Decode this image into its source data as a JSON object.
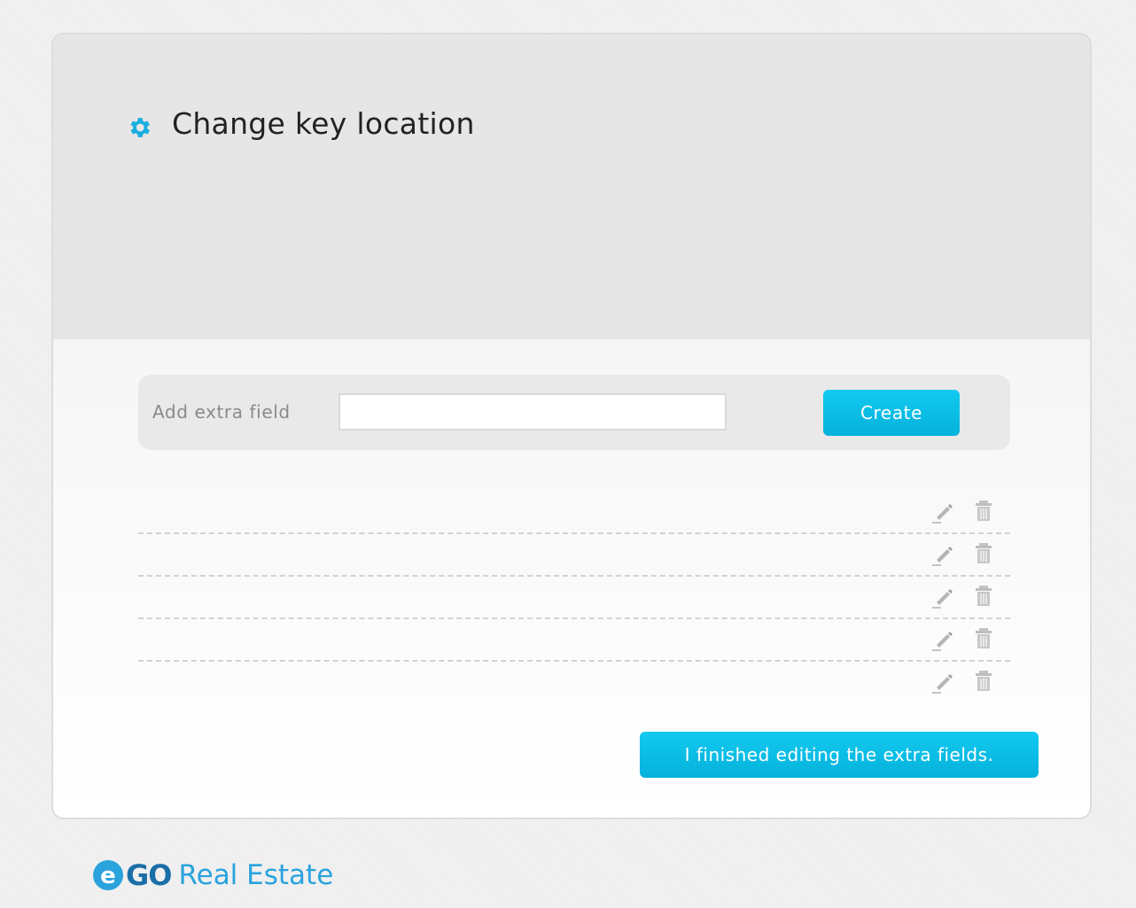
{
  "header": {
    "title": "Change key location",
    "icon": "gear-icon",
    "accent_color": "#1aaee0"
  },
  "add_field": {
    "label": "Add extra field",
    "input_value": "",
    "input_placeholder": "",
    "create_label": "Create",
    "button_color": "#08b7e0"
  },
  "fields": [
    {
      "name": "",
      "edit_icon": "pencil-icon",
      "delete_icon": "trash-icon"
    },
    {
      "name": "",
      "edit_icon": "pencil-icon",
      "delete_icon": "trash-icon"
    },
    {
      "name": "",
      "edit_icon": "pencil-icon",
      "delete_icon": "trash-icon"
    },
    {
      "name": "",
      "edit_icon": "pencil-icon",
      "delete_icon": "trash-icon"
    },
    {
      "name": "",
      "edit_icon": "pencil-icon",
      "delete_icon": "trash-icon"
    }
  ],
  "footer_action": {
    "finish_label": "I finished editing the extra fields."
  },
  "brand": {
    "logo_letter": "e",
    "logo_go": "GO",
    "logo_text": "Real Estate",
    "colors": {
      "dark": "#1b6fa7",
      "light": "#2aa3dd"
    }
  }
}
